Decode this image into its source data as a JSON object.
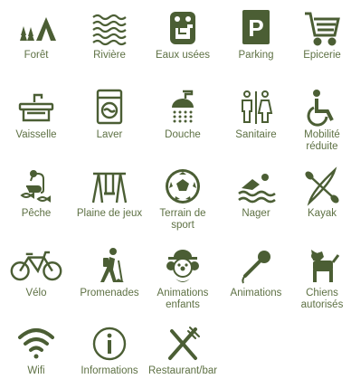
{
  "colors": {
    "icon": "#4b5e34",
    "label": "#5e7144",
    "background": "#ffffff"
  },
  "items": [
    {
      "label": "Forêt",
      "icon": "tents-trees-icon"
    },
    {
      "label": "Rivière",
      "icon": "waves-icon"
    },
    {
      "label": "Eaux usées",
      "icon": "waste-water-icon"
    },
    {
      "label": "Parking",
      "icon": "parking-icon"
    },
    {
      "label": "Epicerie",
      "icon": "shopping-cart-icon"
    },
    {
      "label": "Vaisselle",
      "icon": "sink-icon"
    },
    {
      "label": "Laver",
      "icon": "washing-machine-icon"
    },
    {
      "label": "Douche",
      "icon": "shower-icon"
    },
    {
      "label": "Sanitaire",
      "icon": "restroom-icon"
    },
    {
      "label": "Mobilité réduite",
      "icon": "wheelchair-icon"
    },
    {
      "label": "Pêche",
      "icon": "fishing-icon"
    },
    {
      "label": "Plaine de jeux",
      "icon": "swing-icon"
    },
    {
      "label": "Terrain de sport",
      "icon": "soccer-ball-icon"
    },
    {
      "label": "Nager",
      "icon": "swimmer-icon"
    },
    {
      "label": "Kayak",
      "icon": "kayak-icon"
    },
    {
      "label": "Vélo",
      "icon": "bicycle-icon"
    },
    {
      "label": "Promenades",
      "icon": "hiker-icon"
    },
    {
      "label": "Animations enfants",
      "icon": "clown-icon"
    },
    {
      "label": "Animations",
      "icon": "microphone-icon"
    },
    {
      "label": "Chiens autorisés",
      "icon": "dog-icon"
    },
    {
      "label": "Wifi",
      "icon": "wifi-icon"
    },
    {
      "label": "Informations",
      "icon": "info-icon"
    },
    {
      "label": "Restaurant/bar",
      "icon": "fork-knife-icon"
    }
  ]
}
